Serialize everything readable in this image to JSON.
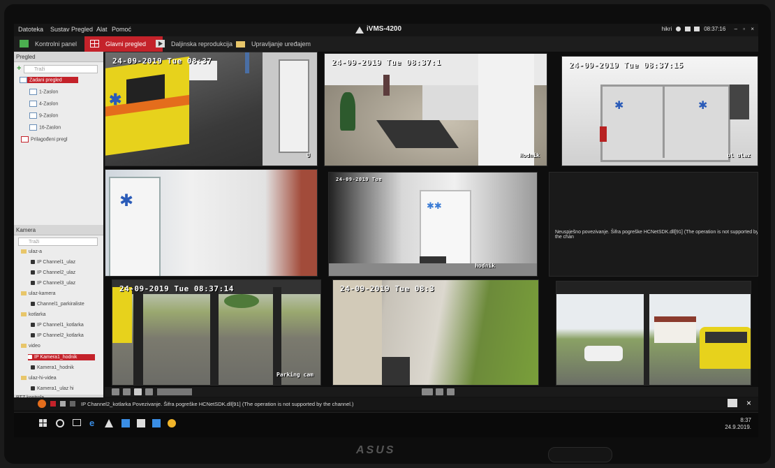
{
  "app": {
    "title": "iVMS-4200",
    "status": "hikri",
    "time": "08:37:16"
  },
  "menu": [
    "Datoteka",
    "Sustav",
    "Pregled",
    "Alat",
    "Pomoć"
  ],
  "tabs": [
    {
      "label": "Kontrolni panel",
      "active": false
    },
    {
      "label": "Glavni pregled",
      "active": true
    },
    {
      "label": "Daljinska reprodukcija",
      "active": false
    },
    {
      "label": "Upravljanje uređajem",
      "active": false
    }
  ],
  "left_panel": {
    "views_title": "Pregled",
    "views_search": "Traži",
    "view_tree": [
      {
        "label": "Zadani pregled",
        "selected": true
      },
      {
        "label": "1-Zaslon"
      },
      {
        "label": "4-Zaslon"
      },
      {
        "label": "9-Zaslon"
      },
      {
        "label": "16-Zaslon"
      },
      {
        "label": "Prilagođeni pregl"
      }
    ],
    "camera_title": "Kamera",
    "camera_search": "Traži",
    "camera_tree": [
      {
        "label": "ulaz-a",
        "type": "folder"
      },
      {
        "label": "IP Channel1_ulaz",
        "type": "cam"
      },
      {
        "label": "IP Channel2_ulaz",
        "type": "cam"
      },
      {
        "label": "IP Channel3_ulaz",
        "type": "cam"
      },
      {
        "label": "ulaz-kamera",
        "type": "folder"
      },
      {
        "label": "Channel1_parkiraliste",
        "type": "cam"
      },
      {
        "label": "kotlarka",
        "type": "folder"
      },
      {
        "label": "IP Channel1_kotlarka",
        "type": "cam"
      },
      {
        "label": "IP Channel2_kotlarka",
        "type": "cam"
      },
      {
        "label": "video",
        "type": "folder"
      },
      {
        "label": "IP Kamera1_hodnik",
        "type": "cam",
        "selected": true
      },
      {
        "label": "Kamera1_hodnik",
        "type": "cam"
      },
      {
        "label": "ulaz-hi-videa",
        "type": "folder"
      },
      {
        "label": "Kamera1_ulaz hi",
        "type": "cam"
      }
    ],
    "ptz_title": "PTZ kontrola"
  },
  "tiles": [
    {
      "osd": "24-09-2019 Tue 08:37",
      "label": "U"
    },
    {
      "osd": "24-09-2019 Tue 08:37:1",
      "label": "Hodnik"
    },
    {
      "osd": "24-09-2019 Tue 08:37:15",
      "label": "ul ulaz"
    },
    {
      "osd": "",
      "label": ""
    },
    {
      "osd": "24-09-2019 Tue",
      "label": "hodnik"
    },
    {
      "osd": "",
      "label": "",
      "error": "Neuspješno povezivanje. Šifra pogreške HCNetSDK.dll[91] (The operation is not supported by the chan"
    },
    {
      "osd": "24-09-2019 Tue 08:37:14",
      "label": "Parking cam"
    },
    {
      "osd": "24-09-2019 Tue 08:3",
      "label": ""
    },
    {
      "osd": "",
      "label": ""
    }
  ],
  "event_bar": {
    "text": "IP Channel2_kotlarka Povezivanje. Šifra pogreške HCNetSDK.dll[91] (The operation is not supported by the channel.)"
  },
  "taskbar": {
    "time": "8:37",
    "date": "24.9.2019."
  },
  "monitor_brand": "ASUS",
  "colors": {
    "accent": "#c4222a",
    "bg": "#121212"
  }
}
